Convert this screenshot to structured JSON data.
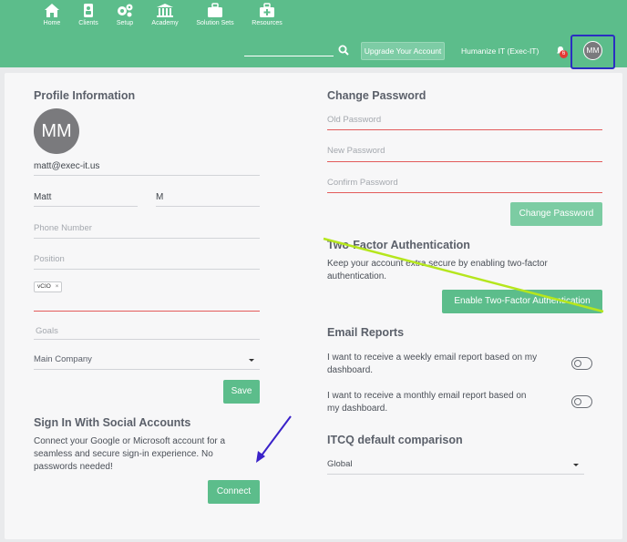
{
  "nav": [
    {
      "label": "Home",
      "icon": "home-icon"
    },
    {
      "label": "Clients",
      "icon": "clients-icon"
    },
    {
      "label": "Setup",
      "icon": "gears-icon"
    },
    {
      "label": "Academy",
      "icon": "academy-icon"
    },
    {
      "label": "Solution Sets",
      "icon": "briefcase-icon"
    },
    {
      "label": "Resources",
      "icon": "first-aid-icon"
    }
  ],
  "header": {
    "upgrade_label": "Upgrade Your Account",
    "org_name": "Humanize IT (Exec-IT)",
    "notification_count": "6",
    "avatar_initials": "MM"
  },
  "profile": {
    "title": "Profile Information",
    "avatar_initials": "MM",
    "email": "matt@exec-it.us",
    "first_name": "Matt",
    "last_name": "M",
    "phone_placeholder": "Phone Number",
    "position_placeholder": "Position",
    "position_tag": "vCIO",
    "tag_remove": "×",
    "goals_placeholder": "Goals",
    "company": "Main Company",
    "save_label": "Save"
  },
  "social": {
    "title": "Sign In With Social Accounts",
    "line1": "Connect your Google or Microsoft account for a",
    "line2": "seamless and secure sign-in experience. No",
    "line3": "passwords needed!",
    "connect_label": "Connect"
  },
  "password": {
    "title": "Change Password",
    "old_placeholder": "Old Password",
    "new_placeholder": "New Password",
    "confirm_placeholder": "Confirm Password",
    "button_label": "Change Password"
  },
  "two_factor": {
    "title": "Two-Factor Authentication",
    "line1": "Keep your account extra secure by enabling two-factor",
    "line2": "authentication.",
    "button_label": "Enable Two-Factor Authentication"
  },
  "email_reports": {
    "title": "Email Reports",
    "weekly_line1": "I want to receive a weekly email report based on my",
    "weekly_line2": "dashboard.",
    "weekly_enabled": false,
    "monthly_line1": "I want to receive a monthly email report based on",
    "monthly_line2": "my dashboard.",
    "monthly_enabled": false
  },
  "itcq": {
    "title": "ITCQ default comparison",
    "value": "Global"
  },
  "colors": {
    "brand_green": "#5cbd8b",
    "highlight_blue": "#2a2ec2",
    "annotation_yellow_green": "#b5e61d",
    "error_red": "#e35b5b"
  }
}
